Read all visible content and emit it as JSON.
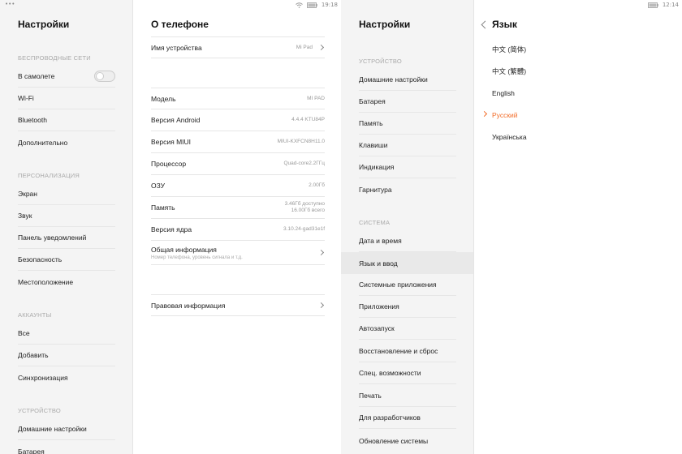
{
  "panel1": {
    "title": "Настройки",
    "sections": [
      {
        "label": "БЕСПРОВОДНЫЕ СЕТИ",
        "items": [
          "В самолете",
          "Wi-Fi",
          "Bluetooth",
          "Дополнительно"
        ]
      },
      {
        "label": "ПЕРСОНАЛИЗАЦИЯ",
        "items": [
          "Экран",
          "Звук",
          "Панель уведомлений",
          "Безопасность",
          "Местоположение"
        ]
      },
      {
        "label": "АККАУНТЫ",
        "items": [
          "Все",
          "Добавить",
          "Синхронизация"
        ]
      },
      {
        "label": "УСТРОЙСТВО",
        "items": [
          "Домашние настройки",
          "Батарея"
        ]
      }
    ],
    "airplane_toggle": "off"
  },
  "panel2": {
    "title": "О телефоне",
    "time": "19:18",
    "device_name": {
      "label": "Имя устройства",
      "value": "Mi Pad"
    },
    "rows": [
      {
        "label": "Модель",
        "value": "MI PAD"
      },
      {
        "label": "Версия Android",
        "value": "4.4.4 KTU84P"
      },
      {
        "label": "Версия MIUI",
        "value": "MIUI-KXFCN8H11.0"
      },
      {
        "label": "Процессор",
        "value": "Quad-core2.2ГГц"
      },
      {
        "label": "ОЗУ",
        "value": "2.00Гб"
      },
      {
        "label": "Память",
        "value": "3.46Гб доступно",
        "value2": "16.00Гб всего"
      },
      {
        "label": "Версия ядра",
        "value": "3.10.24-gad31e1f"
      }
    ],
    "general": {
      "label": "Общая информация",
      "sub": "Номер телефона, уровень сигнала и т.д."
    },
    "legal": "Правовая информация"
  },
  "panel3": {
    "title": "Настройки",
    "sections": [
      {
        "label": "УСТРОЙСТВО",
        "items": [
          "Домашние настройки",
          "Батарея",
          "Память",
          "Клавиши",
          "Индикация",
          "Гарнитура"
        ]
      },
      {
        "label": "СИСТЕМА",
        "items": [
          "Дата и время",
          "Язык и ввод",
          "Системные приложения",
          "Приложения",
          "Автозапуск",
          "Восстановление и сброс",
          "Спец. возможности",
          "Печать",
          "Для разработчиков",
          "Обновление системы"
        ]
      }
    ],
    "active_item": "Язык и ввод"
  },
  "panel4": {
    "title": "Язык",
    "time": "12:14",
    "languages": [
      "中文 (简体)",
      "中文 (繁體)",
      "English",
      "Русский",
      "Українська"
    ],
    "selected": "Русский",
    "accent": "#f26c28"
  },
  "dots": "•••"
}
